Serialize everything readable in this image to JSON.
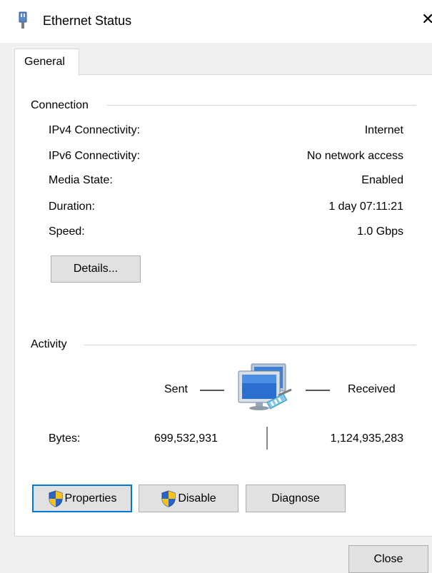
{
  "window": {
    "title": "Ethernet Status",
    "close_glyph": "✕"
  },
  "tabs": [
    {
      "label": "General"
    }
  ],
  "connection": {
    "group_label": "Connection",
    "rows": [
      {
        "label": "IPv4 Connectivity:",
        "value": "Internet"
      },
      {
        "label": "IPv6 Connectivity:",
        "value": "No network access"
      },
      {
        "label": "Media State:",
        "value": "Enabled"
      },
      {
        "label": "Duration:",
        "value": "1 day 07:11:21"
      },
      {
        "label": "Speed:",
        "value": "1.0 Gbps"
      }
    ],
    "details_button": "Details..."
  },
  "activity": {
    "group_label": "Activity",
    "sent_label": "Sent",
    "received_label": "Received",
    "bytes_label": "Bytes:",
    "bytes_sent": "699,532,931",
    "bytes_received": "1,124,935,283",
    "icon": "network-computers-icon"
  },
  "buttons": {
    "properties": "Properties",
    "disable": "Disable",
    "diagnose": "Diagnose",
    "close": "Close"
  },
  "colors": {
    "focus": "#0078d7",
    "shield_blue": "#2b64c5",
    "shield_yellow": "#f4c21d"
  }
}
